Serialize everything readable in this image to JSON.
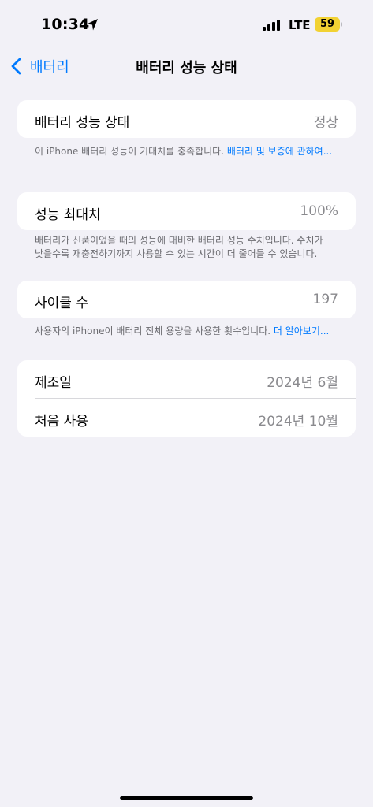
{
  "status_bar": {
    "time": "10:34",
    "network": "LTE",
    "battery": "59",
    "icons": [
      "location-arrow-icon",
      "cellular-signal-icon",
      "battery-icon"
    ]
  },
  "nav": {
    "back_label": "배터리",
    "title": "배터리 성능 상태"
  },
  "health": {
    "label": "배터리 성능 상태",
    "value": "정상",
    "footnote_text": "이 iPhone 배터리 성능이 기대치를 충족합니다. ",
    "footnote_link": "배터리 및 보증에 관하여..."
  },
  "max_capacity": {
    "label": "성능 최대치",
    "value": "100%",
    "footnote_line1": "배터리가 신품이었을 때의 성능에 대비한 배터리 성능 수치입니다. 수치가",
    "footnote_line2": "낮을수록 재충전하기까지 사용할 수 있는 시간이 더 줄어들 수 있습니다."
  },
  "cycle_count": {
    "label": "사이클 수",
    "value": "197",
    "footnote_text": "사용자의 iPhone이 배터리 전체 용량을 사용한 횟수입니다. ",
    "footnote_link": "더 알아보기..."
  },
  "dates": {
    "manufacture_label": "제조일",
    "manufacture_value": "2024년 6월",
    "first_use_label": "처음 사용",
    "first_use_value": "2024년 10월"
  },
  "colors": {
    "accent": "#007aff",
    "background": "#f2f1f7",
    "battery_fill": "#f2d233"
  }
}
